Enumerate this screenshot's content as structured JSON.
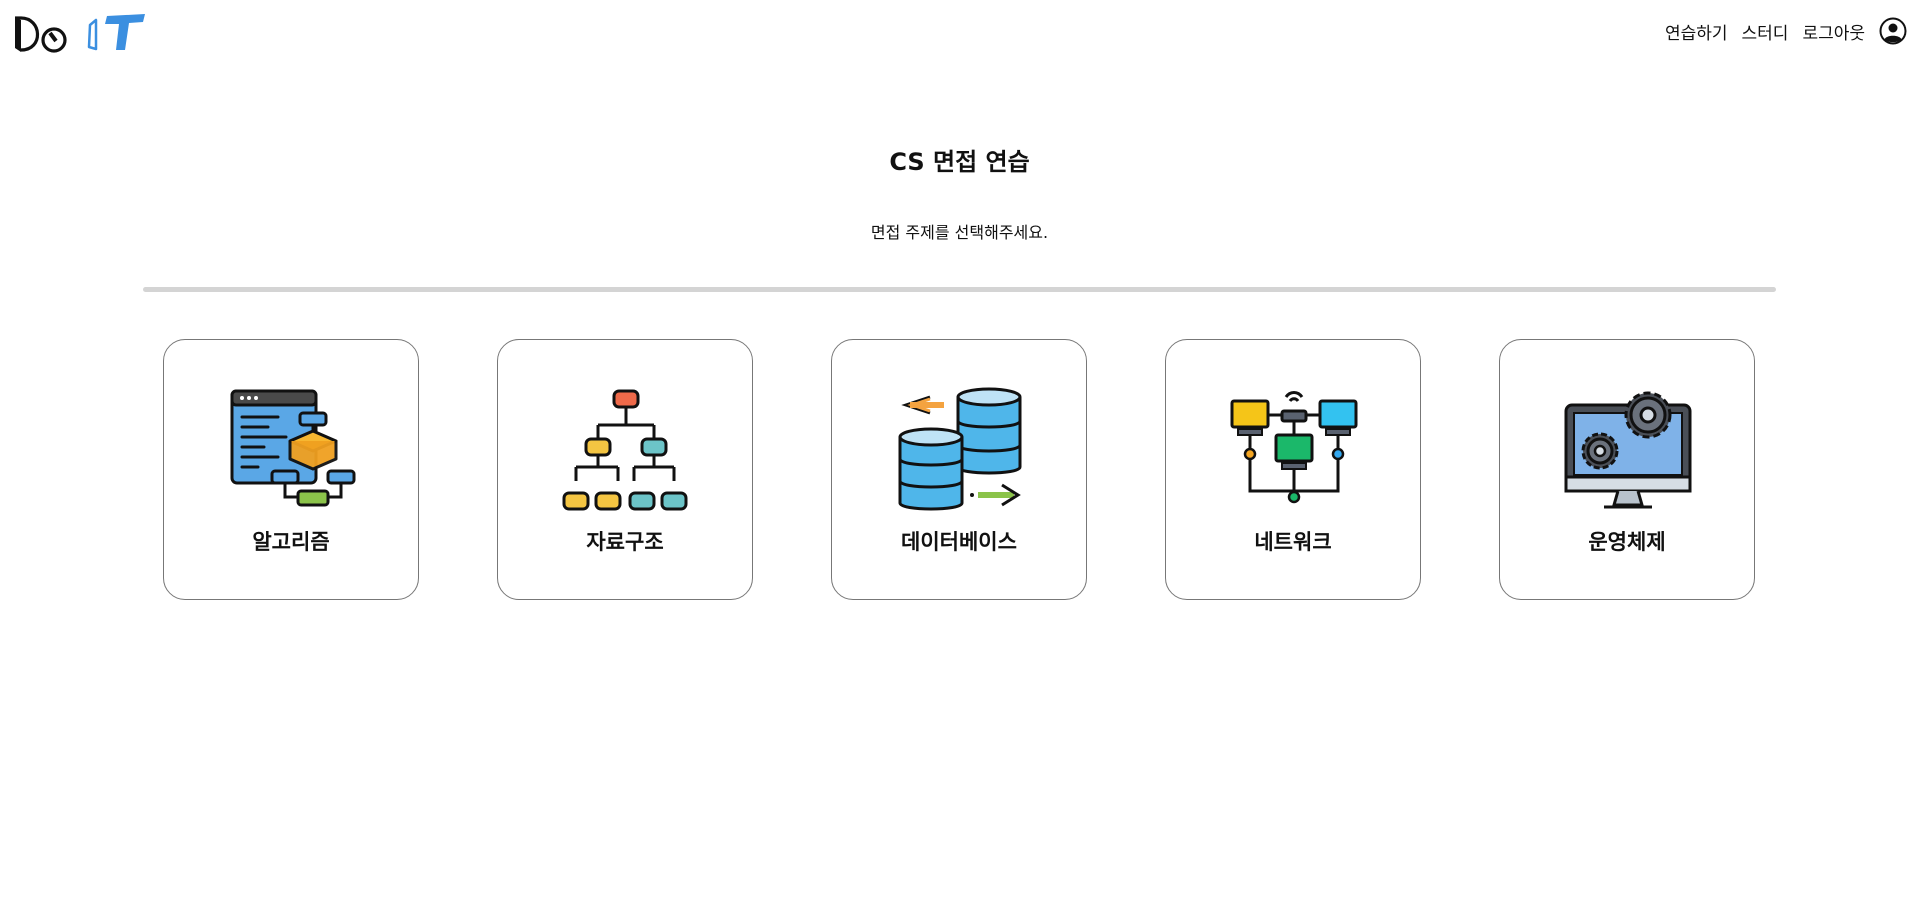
{
  "header": {
    "logo_text": "Do IT",
    "nav": {
      "practice_label": "연습하기",
      "study_label": "스터디",
      "logout_label": "로그아웃"
    }
  },
  "main": {
    "title": "CS 면접 연습",
    "subtitle": "면접 주제를 선택해주세요.",
    "topics": [
      {
        "label": "알고리즘",
        "icon": "algorithm-flowchart-icon"
      },
      {
        "label": "자료구조",
        "icon": "data-structure-tree-icon"
      },
      {
        "label": "데이터베이스",
        "icon": "database-icon"
      },
      {
        "label": "네트워크",
        "icon": "network-icon"
      },
      {
        "label": "운영체제",
        "icon": "operating-system-icon"
      }
    ]
  },
  "colors": {
    "accent_blue": "#3b8fe0",
    "divider": "#d4d4d4",
    "card_border": "#777777"
  }
}
